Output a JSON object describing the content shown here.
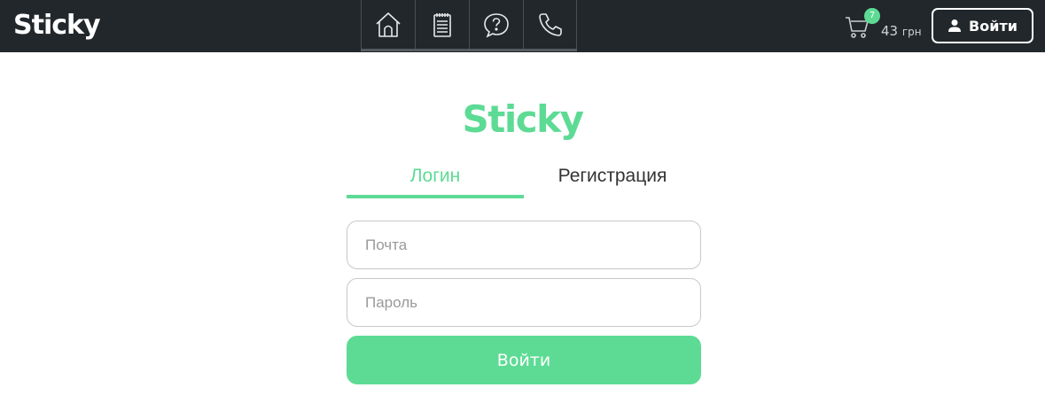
{
  "header": {
    "brand": "Sticky",
    "nav": [
      {
        "name": "home",
        "icon": "home-icon"
      },
      {
        "name": "menu",
        "icon": "notepad-icon"
      },
      {
        "name": "faq",
        "icon": "question-icon"
      },
      {
        "name": "contacts",
        "icon": "phone-icon"
      }
    ],
    "cart": {
      "icon": "cart-icon",
      "count": "7",
      "amount": "43",
      "currency": "грн"
    },
    "login_button": {
      "icon": "user-icon",
      "label": "Войти"
    }
  },
  "form": {
    "logo": "Sticky",
    "tabs": [
      {
        "label": "Логин",
        "active": true
      },
      {
        "label": "Регистрация",
        "active": false
      }
    ],
    "email_placeholder": "Почта",
    "password_placeholder": "Пароль",
    "submit_label": "Войти"
  },
  "colors": {
    "accent": "#5ddb94",
    "header_bg": "#22272b",
    "text": "#333333"
  }
}
